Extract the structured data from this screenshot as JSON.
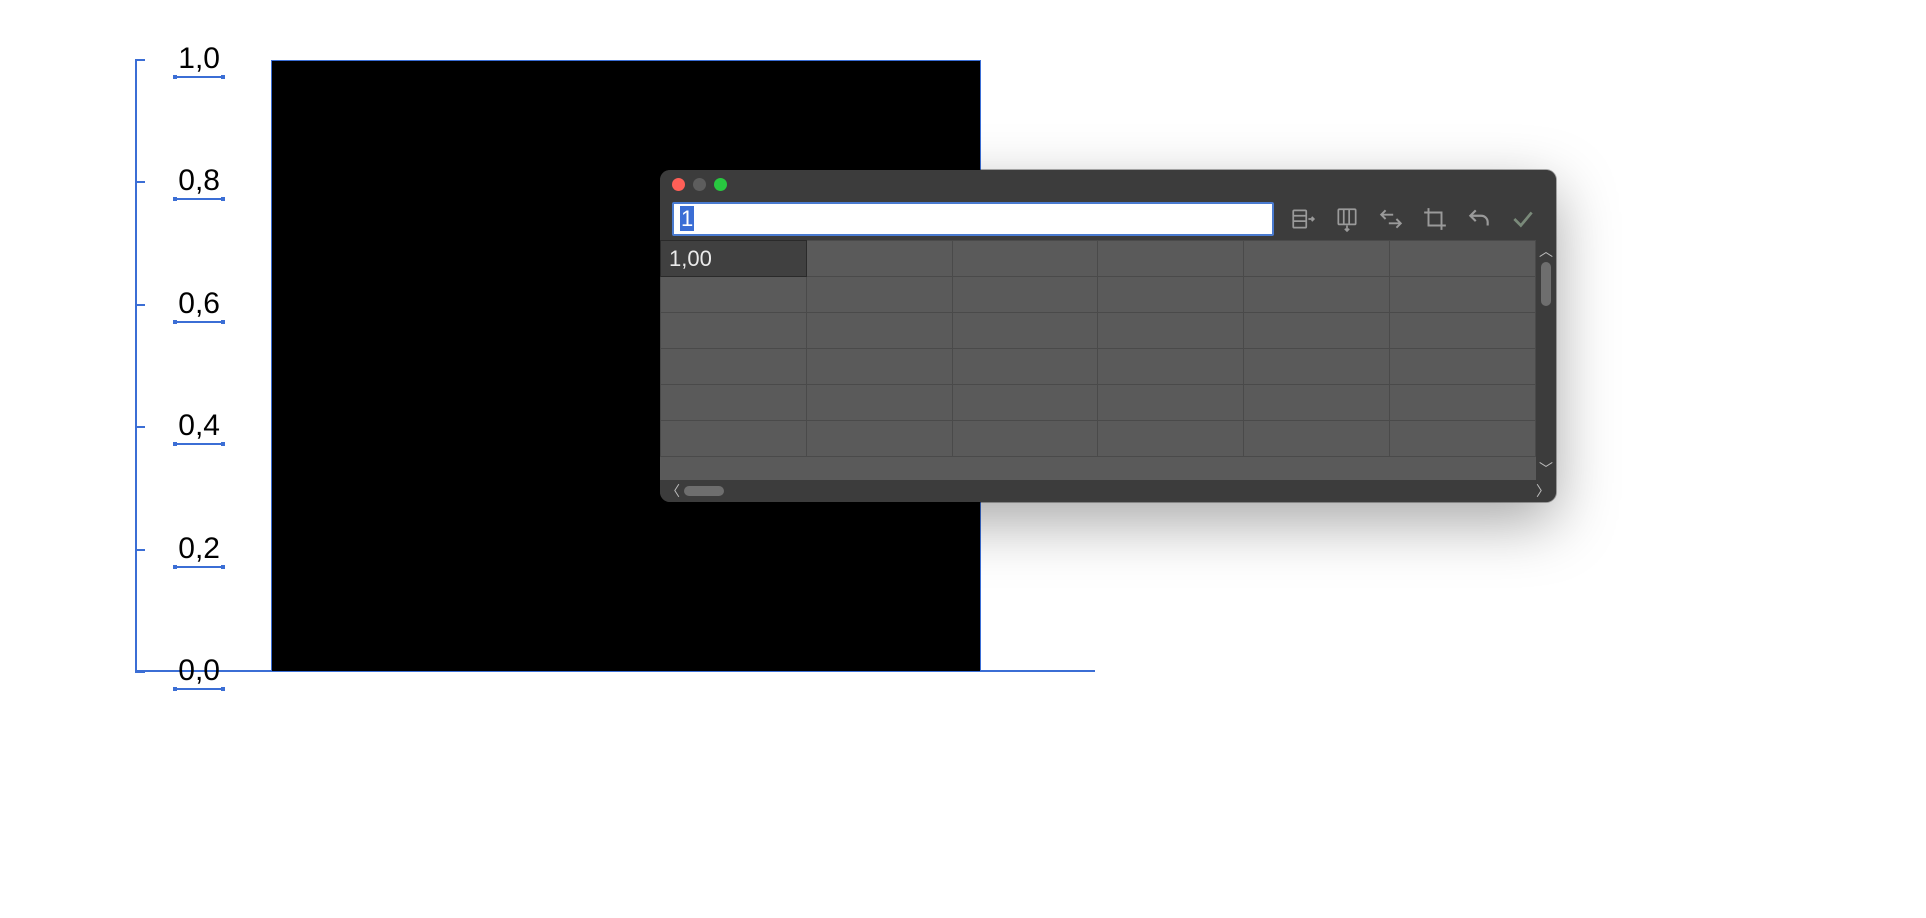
{
  "chart_data": {
    "type": "bar",
    "categories": [
      ""
    ],
    "values": [
      1.0
    ],
    "title": "",
    "xlabel": "",
    "ylabel": "",
    "ylim": [
      0.0,
      1.0
    ],
    "y_ticks": [
      "0,0",
      "0,2",
      "0,4",
      "0,6",
      "0,8",
      "1,0"
    ]
  },
  "window": {
    "formula_value": "1",
    "toolbar_icons": {
      "insert_row": "insert-row",
      "insert_column": "insert-column",
      "swap": "swap-xy",
      "crop": "crop-range",
      "undo": "undo",
      "accept": "accept"
    },
    "grid": {
      "rows": 6,
      "cols": 6,
      "cells": {
        "r0c0": "1,00"
      }
    },
    "scroll": {
      "up": "▲",
      "down": "▼",
      "left": "‹",
      "right": "›"
    }
  }
}
